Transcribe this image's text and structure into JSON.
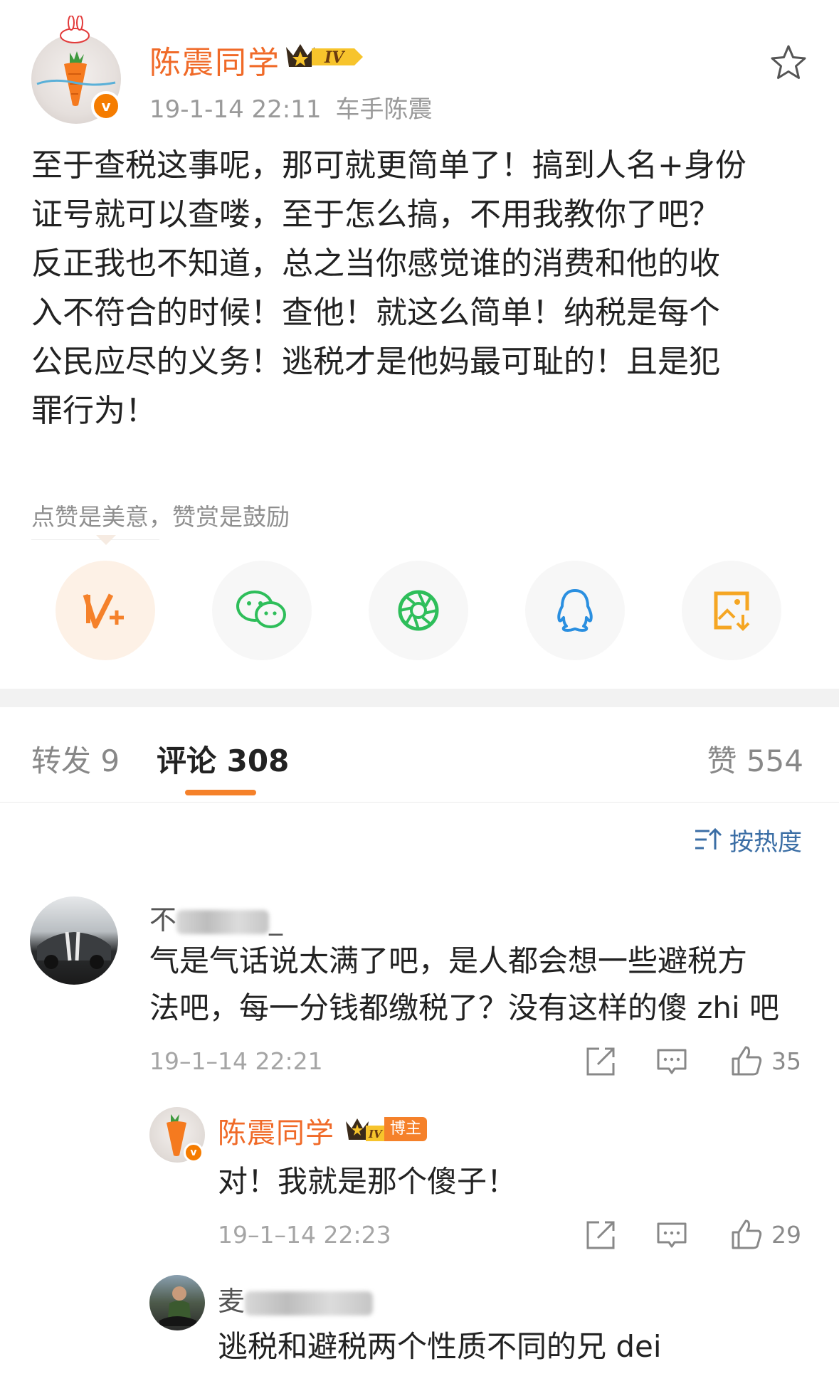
{
  "post": {
    "author": "陈震同学",
    "level_badge": "IV",
    "time": "19-1-14 22:11",
    "source": "车手陈震",
    "text": "至于查税这事呢，那可就更简单了！搞到人名+身份\n证号就可以查喽，至于怎么搞，不用我教你了吧？\n反正我也不知道，总之当你感觉谁的消费和他的收\n入不符合的时候！查他！就这么简单！纳税是每个\n公民应尽的义务！逃税才是他妈最可耻的！且是犯\n罪行为！",
    "tip": "点赞是美意，赞赏是鼓励"
  },
  "share": [
    {
      "name": "v-plus-icon",
      "color": "#f5812a"
    },
    {
      "name": "wechat-icon",
      "color": "#2ebe5a"
    },
    {
      "name": "moments-icon",
      "color": "#2ebe5a"
    },
    {
      "name": "qq-icon",
      "color": "#2a8fe0"
    },
    {
      "name": "save-image-icon",
      "color": "#f5a623"
    }
  ],
  "tabs": {
    "repost": "转发 9",
    "comment": "评论 308",
    "like": "赞 554"
  },
  "sort": {
    "label": "按热度"
  },
  "comments": [
    {
      "name_visible": "不",
      "name_tail": "_",
      "text": "气是气话说太满了吧，是人都会想一些避税方\n法吧，每一分钱都缴税了？没有这样的傻 zhi 吧",
      "time": "19–1–14 22:21",
      "likes": "35"
    },
    {
      "name": "陈震同学",
      "level_badge": "IV",
      "host_tag": "博主",
      "text": "对！我就是那个傻子！",
      "time": "19–1–14 22:23",
      "likes": "29"
    },
    {
      "name_visible": "麦",
      "text": "逃税和避税两个性质不同的兄 dei"
    }
  ],
  "colors": {
    "accent": "#f5812a",
    "author": "#f06a28",
    "link": "#3b6ea5"
  }
}
